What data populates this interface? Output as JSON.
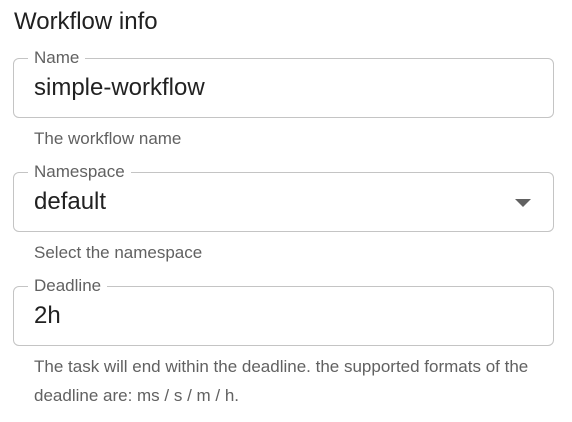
{
  "section": {
    "title": "Workflow info"
  },
  "fields": {
    "name": {
      "label": "Name",
      "value": "simple-workflow",
      "helper": "The workflow name"
    },
    "namespace": {
      "label": "Namespace",
      "value": "default",
      "helper": "Select the namespace",
      "icon": "chevron-down-icon"
    },
    "deadline": {
      "label": "Deadline",
      "value": "2h",
      "helper": "The task will end within the deadline. the supported formats of the deadline are: ms / s / m / h."
    }
  }
}
